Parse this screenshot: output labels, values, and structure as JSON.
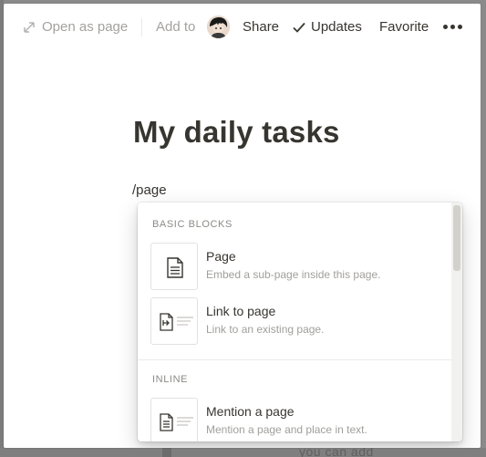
{
  "topbar": {
    "open_as_page": "Open as page",
    "add_to": "Add to",
    "share": "Share",
    "updates": "Updates",
    "favorite": "Favorite"
  },
  "page": {
    "title": "My daily tasks",
    "typed_command": "/page"
  },
  "menu": {
    "basic_blocks_label": "BASIC BLOCKS",
    "inline_label": "INLINE",
    "items": [
      {
        "title": "Page",
        "description": "Embed a sub-page inside this page.",
        "icon": "page-doc-icon"
      },
      {
        "title": "Link to page",
        "description": "Link to an existing page.",
        "icon": "link-to-page-icon"
      },
      {
        "title": "Mention a page",
        "description": "Mention a page and place in text.",
        "icon": "mention-page-icon"
      }
    ]
  },
  "background": {
    "ghost_text": "you can add"
  },
  "colors": {
    "text": "#37352f",
    "muted": "#a3a29f",
    "overlay": "#8a8a8a"
  }
}
